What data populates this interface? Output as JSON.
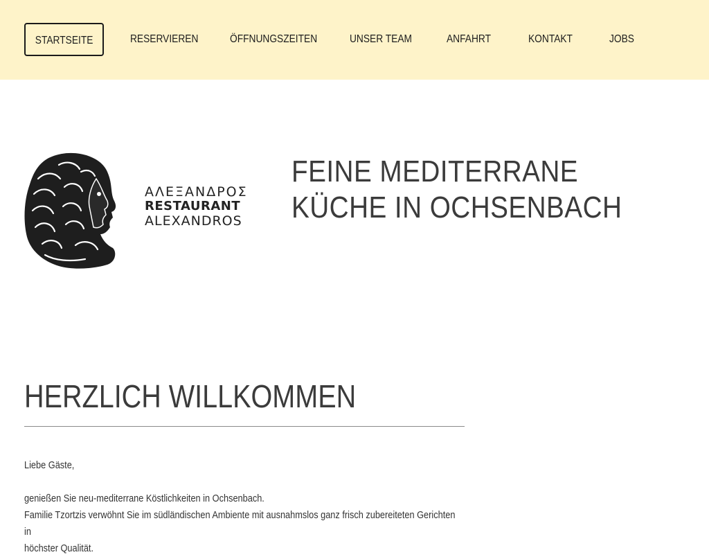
{
  "nav": {
    "items": [
      {
        "label": "STARTSEITE",
        "active": true
      },
      {
        "label": "RESERVIEREN",
        "active": false
      },
      {
        "label": "ÖFFNUNGSZEITEN",
        "active": false
      },
      {
        "label": "UNSER TEAM",
        "active": false
      },
      {
        "label": "ANFAHRT",
        "active": false
      },
      {
        "label": "KONTAKT",
        "active": false
      },
      {
        "label": "JOBS",
        "active": false
      }
    ]
  },
  "logo": {
    "greek": "ΑΛΕΞΑΝΔΡΟΣ",
    "restaurant": "RESTAURANT",
    "latin": "ALEXANDROS",
    "icon": "alexander-head-icon"
  },
  "hero": {
    "title": "FEINE MEDITERRANE KÜCHE IN OCHSENBACH"
  },
  "welcome": {
    "title": "HERZLICH WILLKOMMEN",
    "greeting": "Liebe Gäste,",
    "line1": "genießen  Sie neu-mediterrane Köstlichkeiten in Ochsenbach.",
    "line2": "Familie Tzortzis verwöhnt Sie im südländischen Ambiente mit ausnahmslos ganz frisch zubereiteten Gerichten in",
    "line3": "höchster Qualität."
  },
  "colors": {
    "topbar_bg": "#fef3c9",
    "text_dark": "#3b3b3b"
  }
}
